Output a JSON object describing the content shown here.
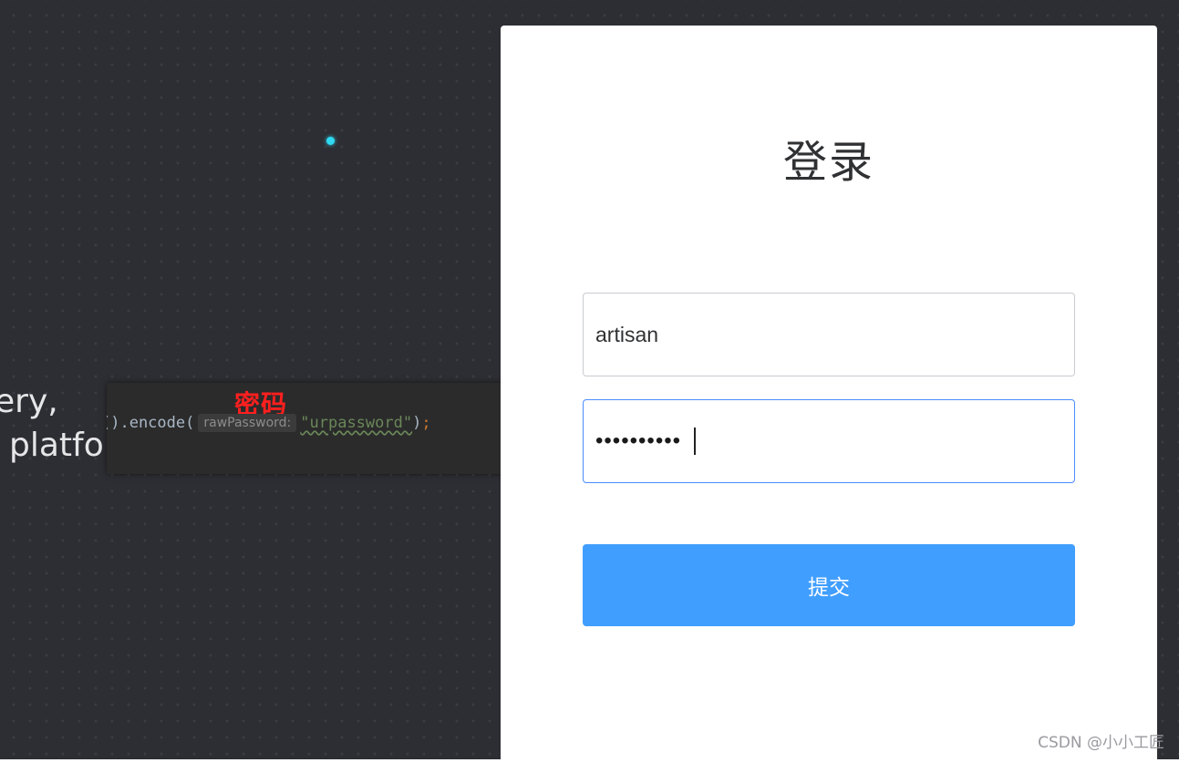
{
  "background": {
    "text_line_1": "ery,",
    "text_line_2": "platfor"
  },
  "code_snippet": {
    "annotation": "密码",
    "code_prefix": "().encode(",
    "param_hint": "rawPassword:",
    "string_value": "\"urpassword\"",
    "code_suffix": ")",
    "semicolon": ";"
  },
  "login": {
    "title": "登录",
    "username_value": "artisan",
    "password_value": "••••••••••",
    "submit_label": "提交"
  },
  "watermark": "CSDN @小小工匠",
  "colors": {
    "primary_button": "#409eff",
    "focus_border": "#4a8dff",
    "annotation_red": "#ff1f1f",
    "accent_dot": "#2fd9f2"
  }
}
